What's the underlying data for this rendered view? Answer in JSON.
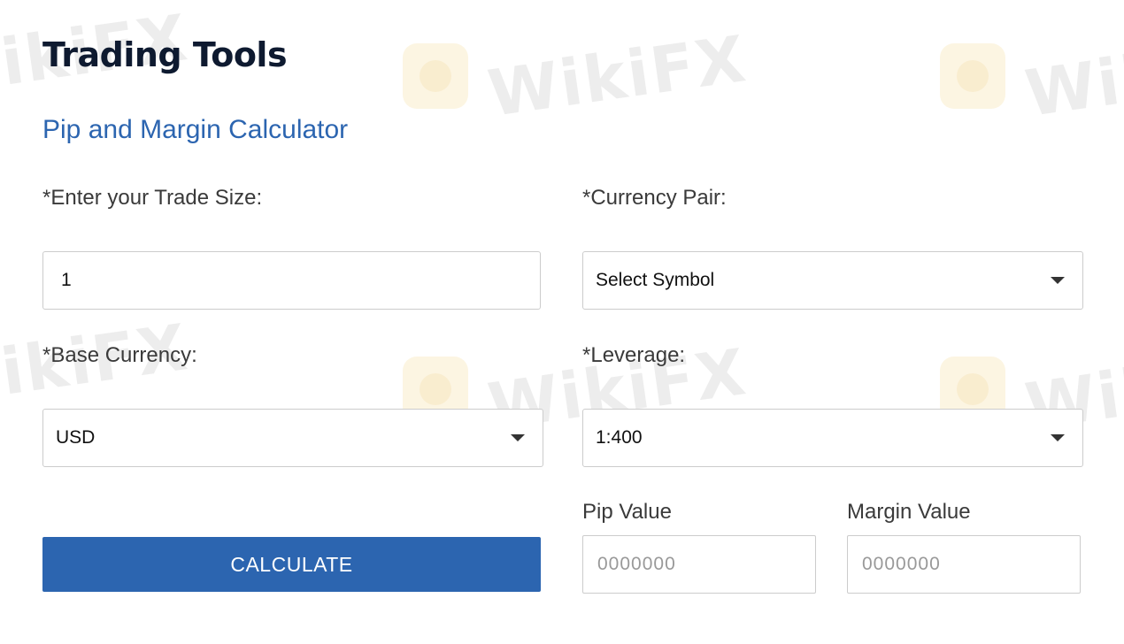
{
  "page": {
    "title": "Trading Tools"
  },
  "calculator": {
    "title": "Pip and Margin Calculator",
    "trade_size": {
      "label": "*Enter your Trade Size:",
      "value": "1"
    },
    "currency_pair": {
      "label": "*Currency Pair:",
      "selected": "Select Symbol"
    },
    "base_currency": {
      "label": "*Base Currency:",
      "selected": "USD"
    },
    "leverage": {
      "label": "*Leverage:",
      "selected": "1:400"
    },
    "calculate_label": "CALCULATE",
    "pip_value": {
      "label": "Pip Value",
      "value": "0000000"
    },
    "margin_value": {
      "label": "Margin Value",
      "value": "0000000"
    }
  },
  "watermark": {
    "text": "WikiFX"
  },
  "colors": {
    "accent": "#2c65b0",
    "title": "#0e1a30",
    "border": "#cccccc",
    "placeholder": "#999999"
  }
}
